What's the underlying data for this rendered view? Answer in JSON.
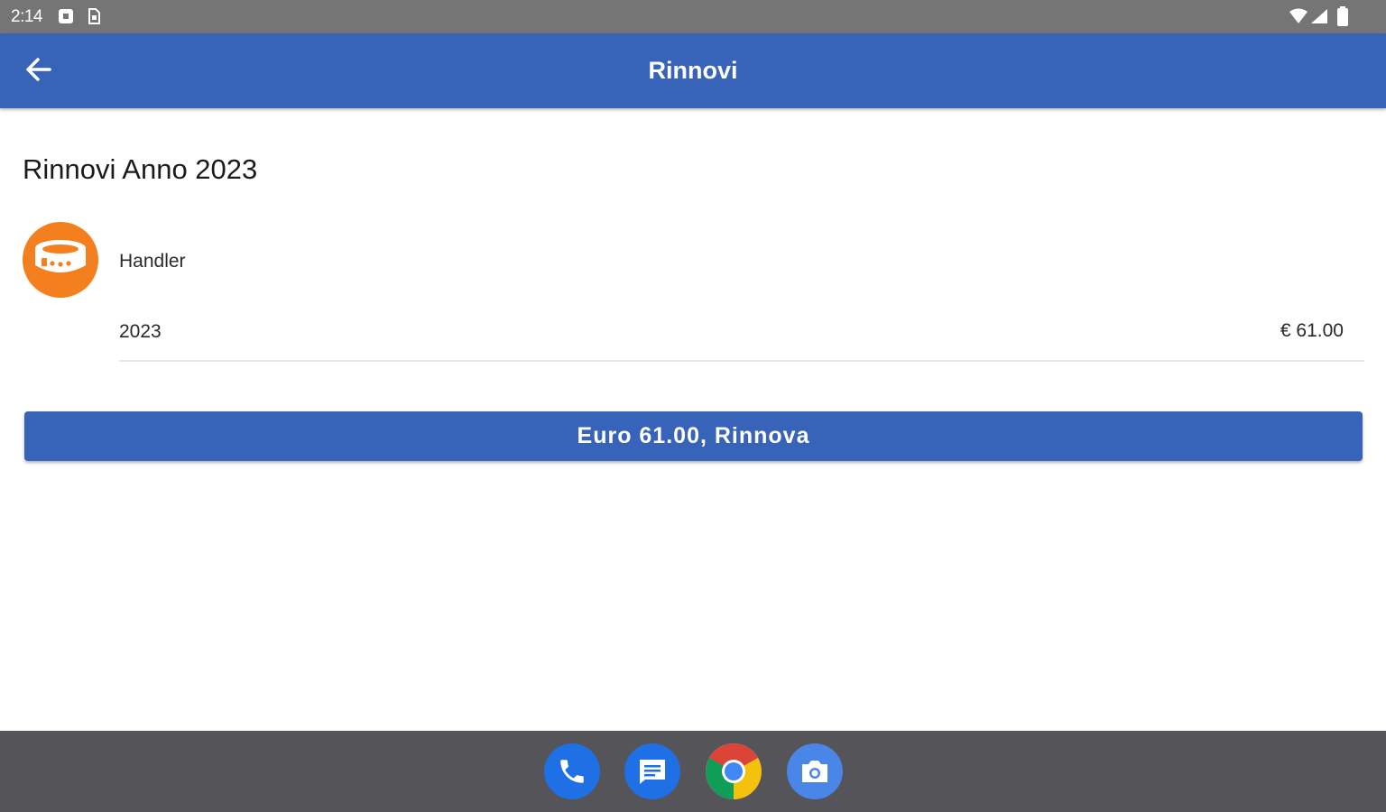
{
  "status_bar": {
    "time": "2:14",
    "icons": [
      "notification-icon",
      "sim-icon",
      "wifi-icon",
      "signal-icon",
      "battery-icon"
    ]
  },
  "app_bar": {
    "title": "Rinnovi",
    "back_icon": "arrow-back-icon"
  },
  "content": {
    "section_title": "Rinnovi Anno 2023",
    "items": [
      {
        "icon": "collar-icon",
        "name": "Handler",
        "year": "2023",
        "price": "€ 61.00"
      }
    ],
    "renew_button_label": "Euro 61.00, Rinnova"
  },
  "dock": {
    "apps": [
      "phone-app-icon",
      "messages-app-icon",
      "chrome-app-icon",
      "camera-app-icon"
    ]
  },
  "colors": {
    "primary": "#3763b8",
    "accent": "#f47f1e",
    "status_bar": "#757575",
    "dock": "#545459"
  }
}
